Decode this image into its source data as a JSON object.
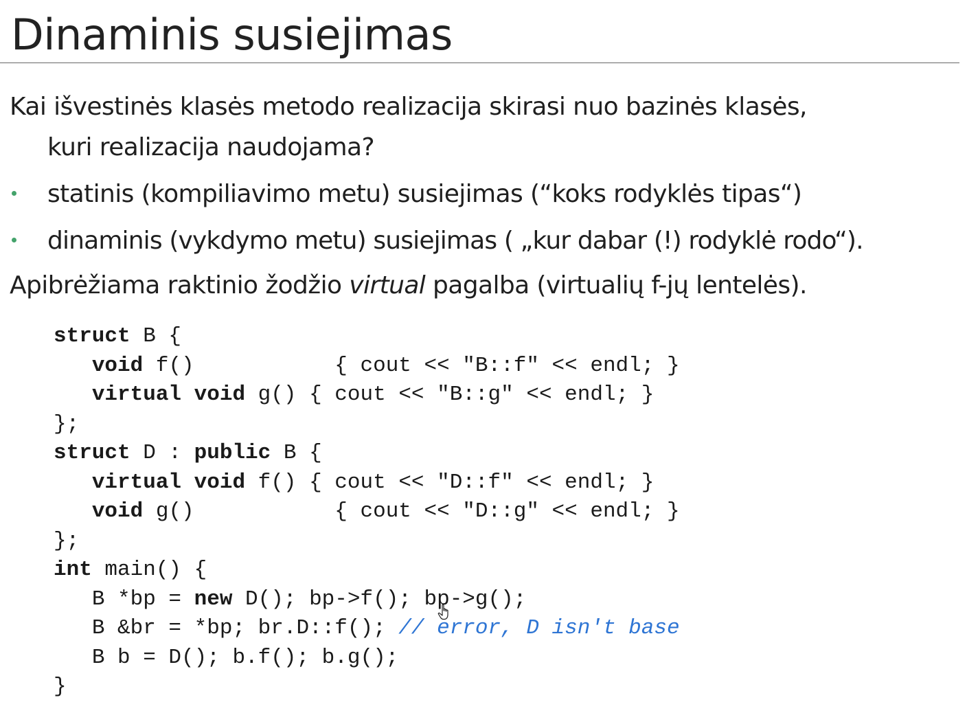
{
  "slide": {
    "title": "Dinaminis susiejimas",
    "intro_line1": "Kai išvestinės klasės metodo realizacija skirasi nuo bazinės klasės,",
    "intro_line2": "kuri realizacija naudojama?",
    "bullets": [
      "statinis (kompiliavimo metu) susiejimas (“koks rodyklės tipas“)",
      "dinaminis (vykdymo metu) susiejimas ( „kur dabar (!) rodyklė rodo“)."
    ],
    "defined_prefix": "Apibrėžiama raktinio žodžio ",
    "defined_keyword": "virtual",
    "defined_suffix": " pagalba (virtualių f-jų lentelės)."
  },
  "code": {
    "l1": {
      "kw": "struct",
      "rest": " B {"
    },
    "l2": {
      "kw": "void",
      "rest": " f()           { cout << \"B::f\" << endl; }"
    },
    "l3": {
      "kw1": "virtual",
      "kw2": "void",
      "rest": " g() { cout << \"B::g\" << endl; }"
    },
    "l4": "};",
    "l5": {
      "kw1": "struct",
      "mid": " D : ",
      "kw2": "public",
      "rest": " B {"
    },
    "l6": {
      "kw1": "virtual",
      "kw2": "void",
      "rest": " f() { cout << \"D::f\" << endl; }"
    },
    "l7": {
      "kw": "void",
      "rest": " g()           { cout << \"D::g\" << endl; }"
    },
    "l8": "};",
    "l9": {
      "kw": "int",
      "rest": " main() {"
    },
    "l10": {
      "pre": "B *bp = ",
      "kw": "new",
      "rest": " D(); bp->f(); bp->g();"
    },
    "l11": {
      "pre": "B &br = *bp; br.D::f(); ",
      "comment": "// error, D isn't base"
    },
    "l12": "B b = D(); b.f(); b.g();",
    "l13": "}"
  },
  "icons": {
    "bullet": "bullet-dot-icon",
    "cursor": "hand-cursor-icon"
  },
  "colors": {
    "bullet": "#44a36b",
    "comment": "#2e75d4",
    "text": "#1f1f1f"
  }
}
